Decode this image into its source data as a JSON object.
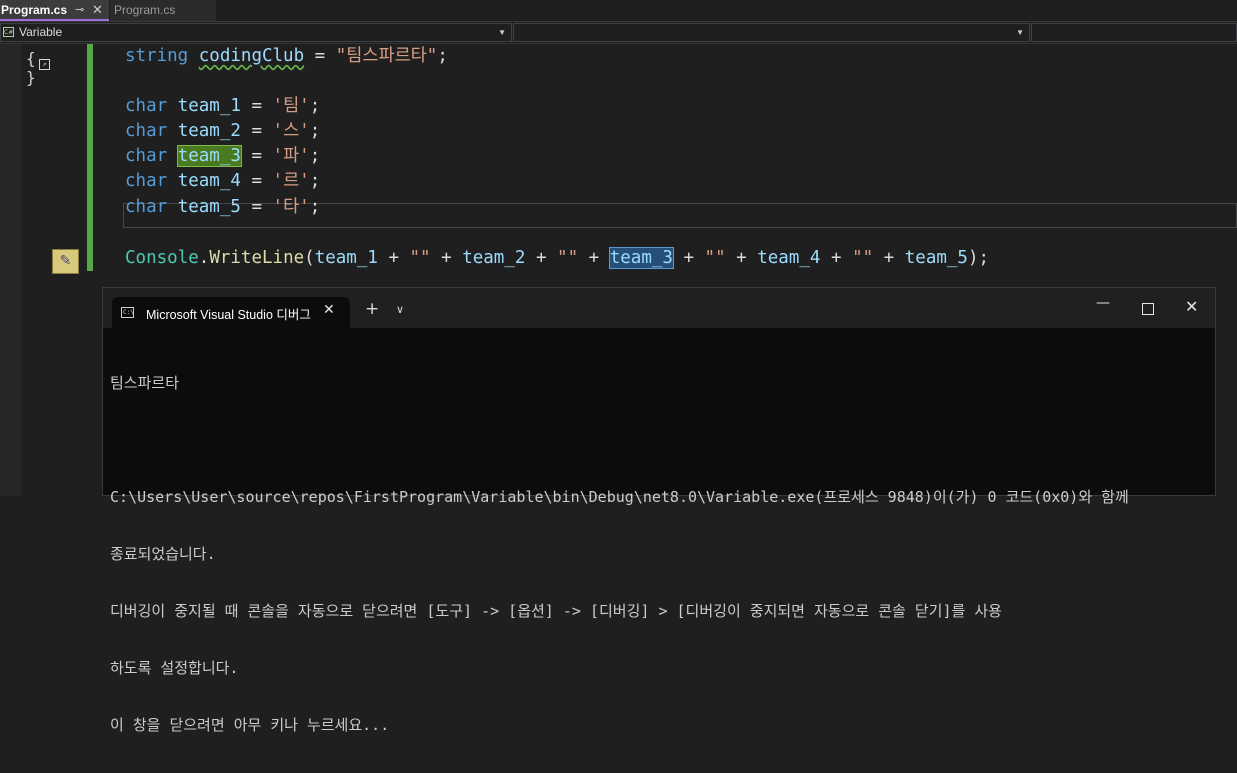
{
  "tabs": [
    {
      "label": "Program.cs",
      "active": true
    },
    {
      "label": "Program.cs",
      "active": false
    }
  ],
  "tab_icons": {
    "pin": "pin-icon",
    "close": "close-icon"
  },
  "navbar": {
    "project": "Variable",
    "project_icon": "csharp-project-icon",
    "type_combo": "",
    "member_combo": ""
  },
  "code": {
    "line1": {
      "type": "string",
      "name": "codingClub",
      "op": " = ",
      "value": "\"팀스파르타\"",
      "end": ";"
    },
    "chars": [
      {
        "type": "char",
        "name": "team_1",
        "op": " = ",
        "value": "'팀'",
        "end": ";"
      },
      {
        "type": "char",
        "name": "team_2",
        "op": " = ",
        "value": "'스'",
        "end": ";"
      },
      {
        "type": "char",
        "name": "team_3",
        "op": " = ",
        "value": "'파'",
        "end": ";"
      },
      {
        "type": "char",
        "name": "team_4",
        "op": " = ",
        "value": "'르'",
        "end": ";"
      },
      {
        "type": "char",
        "name": "team_5",
        "op": " = ",
        "value": "'타'",
        "end": ";"
      }
    ],
    "writeline": {
      "cls": "Console",
      "dot": ".",
      "method": "WriteLine",
      "open": "(",
      "a1": "team_1",
      "plus": " + ",
      "empty": "\"\"",
      "a2": "team_2",
      "a3": "team_3",
      "a4": "team_4",
      "a5": "team_5",
      "close": ");"
    }
  },
  "terminal": {
    "tab_title": "Microsoft Visual Studio 디버그",
    "output": [
      "팀스파르타",
      "",
      "C:\\Users\\User\\source\\repos\\FirstProgram\\Variable\\bin\\Debug\\net8.0\\Variable.exe(프로세스 9848)이(가) 0 코드(0x0)와 함께",
      "종료되었습니다.",
      "디버깅이 중지될 때 콘솔을 자동으로 닫으려면 [도구] -> [옵션] -> [디버깅] > [디버깅이 중지되면 자동으로 콘솔 닫기]를 사용",
      "하도록 설정합니다.",
      "이 창을 닫으려면 아무 키나 누르세요..."
    ]
  },
  "colors": {
    "change_bar": "#57a64a",
    "keyword": "#569cd6",
    "string": "#d69d85",
    "variable": "#9cdcfe",
    "class": "#4ec9b0",
    "method": "#dcdcaa"
  }
}
